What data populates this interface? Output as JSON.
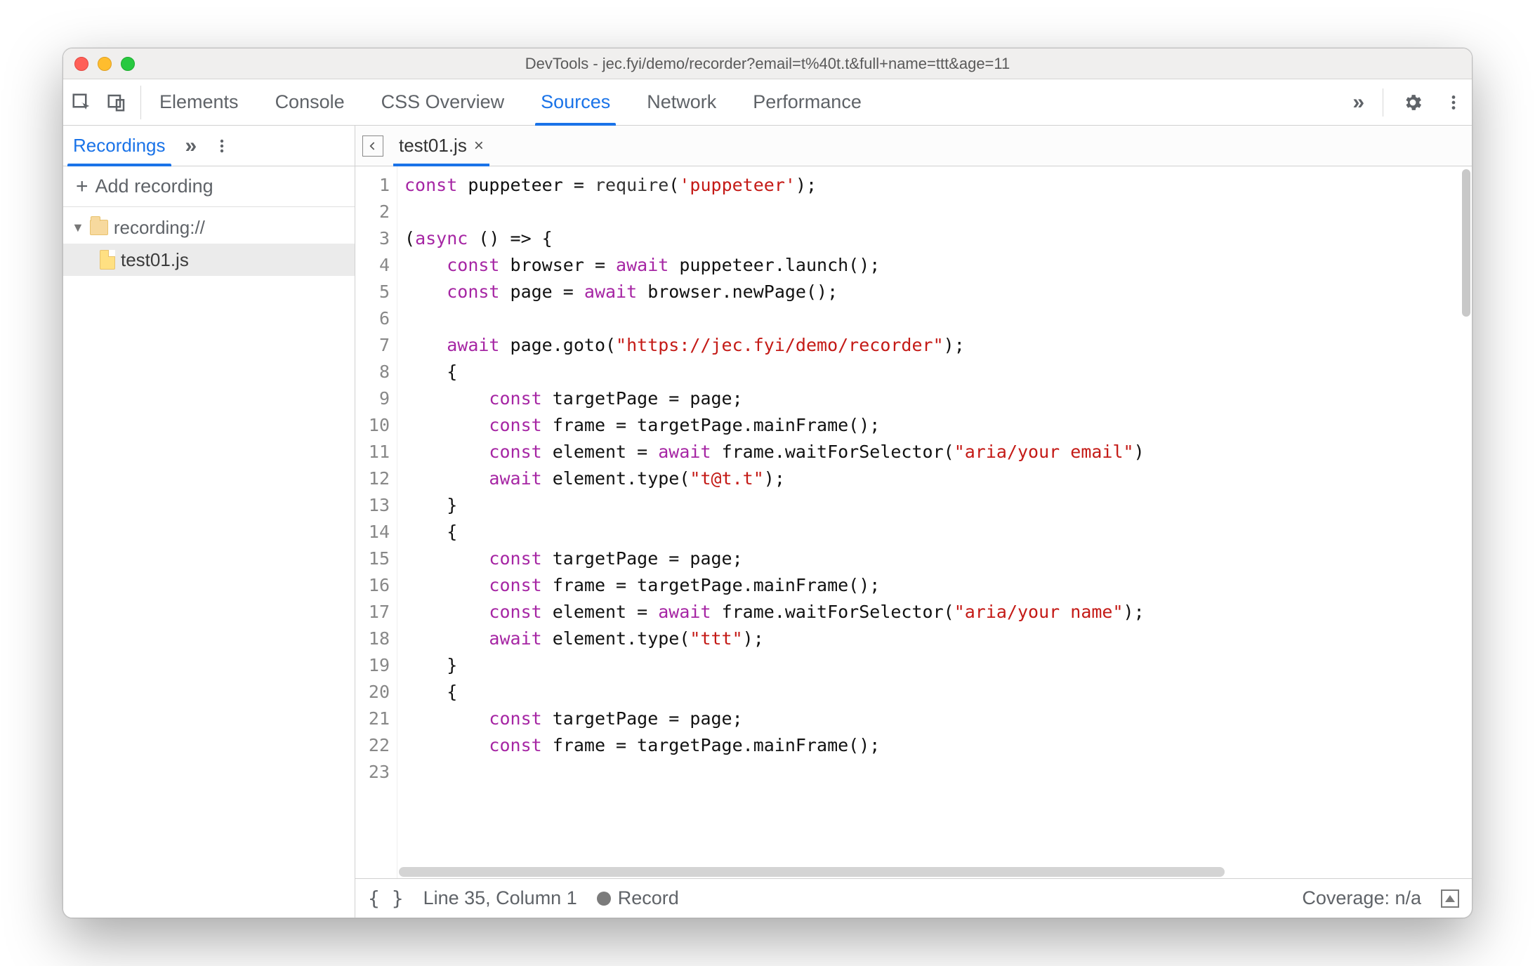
{
  "window": {
    "title": "DevTools - jec.fyi/demo/recorder?email=t%40t.t&full+name=ttt&age=11"
  },
  "toolbar": {
    "tabs": [
      "Elements",
      "Console",
      "CSS Overview",
      "Sources",
      "Network",
      "Performance"
    ],
    "active_tab_index": 3,
    "more_glyph": "»"
  },
  "sidebar": {
    "tab_label": "Recordings",
    "more_glyph": "»",
    "add_label": "Add recording",
    "tree": {
      "folder_label": "recording://",
      "file_label": "test01.js"
    }
  },
  "editor": {
    "tab_filename": "test01.js",
    "gutter_lines": "1\n2\n3\n4\n5\n6\n7\n8\n9\n10\n11\n12\n13\n14\n15\n16\n17\n18\n19\n20\n21\n22\n23",
    "code_tokens": [
      {
        "t": "const ",
        "c": "kw"
      },
      {
        "t": "puppeteer = ",
        "c": ""
      },
      {
        "t": "require",
        "c": "fn"
      },
      {
        "t": "(",
        "c": ""
      },
      {
        "t": "'puppeteer'",
        "c": "str"
      },
      {
        "t": ");\n",
        "c": ""
      },
      {
        "t": "\n",
        "c": ""
      },
      {
        "t": "(",
        "c": ""
      },
      {
        "t": "async",
        "c": "kw"
      },
      {
        "t": " () => {\n",
        "c": ""
      },
      {
        "t": "    ",
        "c": ""
      },
      {
        "t": "const ",
        "c": "kw"
      },
      {
        "t": "browser = ",
        "c": ""
      },
      {
        "t": "await ",
        "c": "kw"
      },
      {
        "t": "puppeteer.launch();\n",
        "c": ""
      },
      {
        "t": "    ",
        "c": ""
      },
      {
        "t": "const ",
        "c": "kw"
      },
      {
        "t": "page = ",
        "c": ""
      },
      {
        "t": "await ",
        "c": "kw"
      },
      {
        "t": "browser.newPage();\n",
        "c": ""
      },
      {
        "t": "\n",
        "c": ""
      },
      {
        "t": "    ",
        "c": ""
      },
      {
        "t": "await ",
        "c": "kw"
      },
      {
        "t": "page.goto(",
        "c": ""
      },
      {
        "t": "\"https://jec.fyi/demo/recorder\"",
        "c": "str"
      },
      {
        "t": ");\n",
        "c": ""
      },
      {
        "t": "    {\n",
        "c": ""
      },
      {
        "t": "        ",
        "c": ""
      },
      {
        "t": "const ",
        "c": "kw"
      },
      {
        "t": "targetPage = page;\n",
        "c": ""
      },
      {
        "t": "        ",
        "c": ""
      },
      {
        "t": "const ",
        "c": "kw"
      },
      {
        "t": "frame = targetPage.mainFrame();\n",
        "c": ""
      },
      {
        "t": "        ",
        "c": ""
      },
      {
        "t": "const ",
        "c": "kw"
      },
      {
        "t": "element = ",
        "c": ""
      },
      {
        "t": "await ",
        "c": "kw"
      },
      {
        "t": "frame.waitForSelector(",
        "c": ""
      },
      {
        "t": "\"aria/your email\"",
        "c": "str"
      },
      {
        "t": ")\n",
        "c": ""
      },
      {
        "t": "        ",
        "c": ""
      },
      {
        "t": "await ",
        "c": "kw"
      },
      {
        "t": "element.type(",
        "c": ""
      },
      {
        "t": "\"t@t.t\"",
        "c": "str"
      },
      {
        "t": ");\n",
        "c": ""
      },
      {
        "t": "    }\n",
        "c": ""
      },
      {
        "t": "    {\n",
        "c": ""
      },
      {
        "t": "        ",
        "c": ""
      },
      {
        "t": "const ",
        "c": "kw"
      },
      {
        "t": "targetPage = page;\n",
        "c": ""
      },
      {
        "t": "        ",
        "c": ""
      },
      {
        "t": "const ",
        "c": "kw"
      },
      {
        "t": "frame = targetPage.mainFrame();\n",
        "c": ""
      },
      {
        "t": "        ",
        "c": ""
      },
      {
        "t": "const ",
        "c": "kw"
      },
      {
        "t": "element = ",
        "c": ""
      },
      {
        "t": "await ",
        "c": "kw"
      },
      {
        "t": "frame.waitForSelector(",
        "c": ""
      },
      {
        "t": "\"aria/your name\"",
        "c": "str"
      },
      {
        "t": ");\n",
        "c": ""
      },
      {
        "t": "        ",
        "c": ""
      },
      {
        "t": "await ",
        "c": "kw"
      },
      {
        "t": "element.type(",
        "c": ""
      },
      {
        "t": "\"ttt\"",
        "c": "str"
      },
      {
        "t": ");\n",
        "c": ""
      },
      {
        "t": "    }\n",
        "c": ""
      },
      {
        "t": "    {\n",
        "c": ""
      },
      {
        "t": "        ",
        "c": ""
      },
      {
        "t": "const ",
        "c": "kw"
      },
      {
        "t": "targetPage = page;\n",
        "c": ""
      },
      {
        "t": "        ",
        "c": ""
      },
      {
        "t": "const ",
        "c": "kw"
      },
      {
        "t": "frame = targetPage.mainFrame();\n",
        "c": ""
      }
    ]
  },
  "statusbar": {
    "braces": "{ }",
    "position": "Line 35, Column 1",
    "record_label": "Record",
    "coverage": "Coverage: n/a"
  }
}
